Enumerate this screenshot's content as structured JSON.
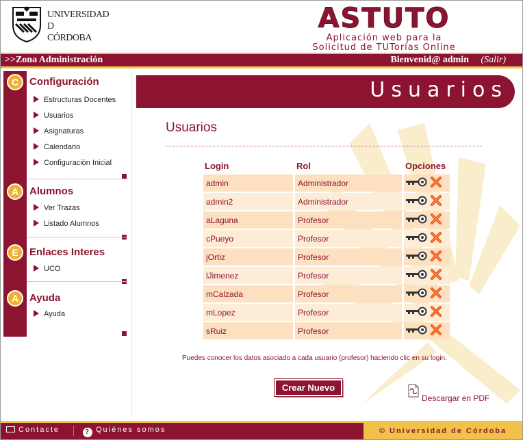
{
  "header": {
    "university_lines": [
      "UNIVERSIDAD",
      "D",
      "CÓRDOBA"
    ],
    "brand_title": "ASTUTO",
    "brand_subtitle_lines": [
      "Aplicación web para la",
      "Solicitud de TUTorías Online"
    ]
  },
  "topbar": {
    "zona": ">>Zona Administración",
    "welcome": "Bienvenid@ admin",
    "logout": "(Salir)"
  },
  "sidebar": {
    "sections": [
      {
        "badge": "C",
        "title": "Configuración",
        "items": [
          "Estructuras Docentes",
          "Usuarios",
          "Asignaturas",
          "Calendario",
          "Configuración Inicial"
        ]
      },
      {
        "badge": "A",
        "title": "Alumnos",
        "items": [
          "Ver Trazas",
          "Listado Alumnos"
        ]
      },
      {
        "badge": "E",
        "title": "Enlaces Interes",
        "items": [
          "UCO"
        ]
      },
      {
        "badge": "A",
        "title": "Ayuda",
        "items": [
          "Ayuda"
        ]
      }
    ]
  },
  "main": {
    "banner_title": "Usuarios",
    "heading": "Usuarios",
    "table": {
      "headers": [
        "Login",
        "Rol",
        "Opciones"
      ],
      "rows": [
        {
          "login": "admin",
          "rol": "Administrador"
        },
        {
          "login": "admin2",
          "rol": "Administrador"
        },
        {
          "login": "aLaguna",
          "rol": "Profesor"
        },
        {
          "login": "cPueyo",
          "rol": "Profesor"
        },
        {
          "login": "jOrtiz",
          "rol": "Profesor"
        },
        {
          "login": "lJimenez",
          "rol": "Profesor"
        },
        {
          "login": "mCalzada",
          "rol": "Profesor"
        },
        {
          "login": "mLopez",
          "rol": "Profesor"
        },
        {
          "login": "sRuiz",
          "rol": "Profesor"
        }
      ]
    },
    "info_text": "Puedes conocer los datos asociado a cada usuario (profesor) haciendo clic en su login.",
    "create_button": "Crear Nuevo",
    "pdf_link": "Descargar en PDF"
  },
  "footer": {
    "contacte": "Contacte",
    "quienes": "Quiénes somos",
    "copyright": "© Universidad de Córdoba"
  },
  "colors": {
    "primary": "#8c1430",
    "accent": "#f0c24a",
    "row": "#fde0bf"
  }
}
